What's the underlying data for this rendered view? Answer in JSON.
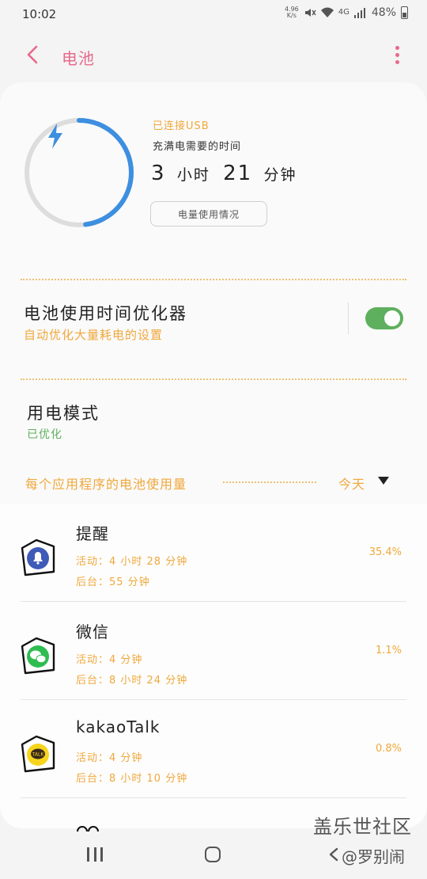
{
  "status_bar": {
    "time": "10:02",
    "network_speed": "4.96",
    "network_unit": "K/s",
    "network_type": "4G",
    "battery_percent": "48%",
    "icons": [
      "mute-icon",
      "wifi-icon",
      "signal-icon",
      "battery-charging-icon"
    ]
  },
  "header": {
    "title": "电池"
  },
  "charging": {
    "connection": "已连接USB",
    "full_label": "充满电需要的时间",
    "hours": "3",
    "hours_unit": "小时",
    "minutes": "21",
    "minutes_unit": "分钟",
    "charge_level": 0.48,
    "usage_button": "电量使用情况"
  },
  "optimizer": {
    "title": "电池使用时间优化器",
    "subtitle": "自动优化大量耗电的设置",
    "enabled": true
  },
  "power_mode": {
    "title": "用电模式",
    "subtitle": "已优化"
  },
  "per_app": {
    "title": "每个应用程序的电池使用量",
    "period": "今天",
    "apps": [
      {
        "name": "提醒",
        "active": "活动：4 小时 28 分钟",
        "background": "后台：55 分钟",
        "percent": "35.4%",
        "icon": "reminder-bell-icon"
      },
      {
        "name": "微信",
        "active": "活动：4 分钟",
        "background": "后台：8 小时 24 分钟",
        "percent": "1.1%",
        "icon": "wechat-icon"
      },
      {
        "name": "kakaoTalk",
        "active": "活动：4 分钟",
        "background": "后台：8 小时 10 分钟",
        "percent": "0.8%",
        "icon": "kakaotalk-icon"
      }
    ]
  },
  "watermark": {
    "line1": "盖乐世社区",
    "line2": "@罗别闹"
  },
  "colors": {
    "accent_pink": "#e8698a",
    "accent_orange": "#f0a83c",
    "accent_green": "#5eb05e",
    "ring_blue": "#3d8fe0",
    "ring_track": "#dddddd"
  }
}
